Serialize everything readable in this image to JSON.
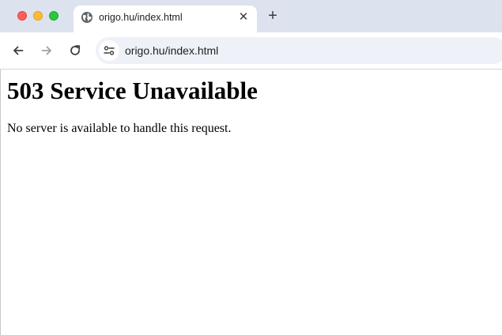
{
  "window": {
    "traffic_lights": {
      "close": "#fe5f57",
      "minimize": "#febc2e",
      "maximize": "#28c840"
    }
  },
  "tab": {
    "favicon": "globe-icon",
    "title": "origo.hu/index.html",
    "close_glyph": "✕"
  },
  "new_tab_glyph": "+",
  "toolbar": {
    "back": "arrow-left-icon",
    "forward": "arrow-right-icon",
    "reload": "reload-icon",
    "site_info": "tune-icon",
    "url": "origo.hu/index.html"
  },
  "page": {
    "heading": "503 Service Unavailable",
    "message": "No server is available to handle this request."
  }
}
